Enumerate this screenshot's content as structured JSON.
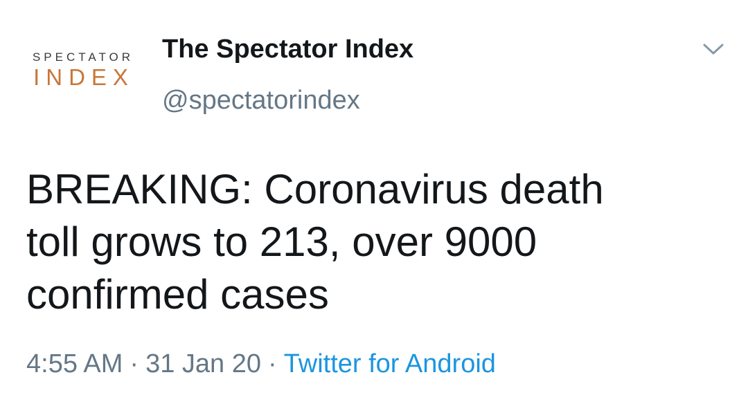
{
  "tweet": {
    "avatar": {
      "line1": "SPECTATOR",
      "line2": "INDEX"
    },
    "display_name": "The Spectator Index",
    "handle": "@spectatorindex",
    "text": "BREAKING: Coronavirus death\ntoll grows to 213, over 9000\nconfirmed cases",
    "time": "4:55 AM",
    "date": "31 Jan 20",
    "separator": "·",
    "source": "Twitter for Android",
    "menu_icon": "chevron-down-icon"
  },
  "colors": {
    "name": "#14171a",
    "secondary": "#657786",
    "link": "#1b95e0",
    "avatar_accent": "#c8763a"
  }
}
